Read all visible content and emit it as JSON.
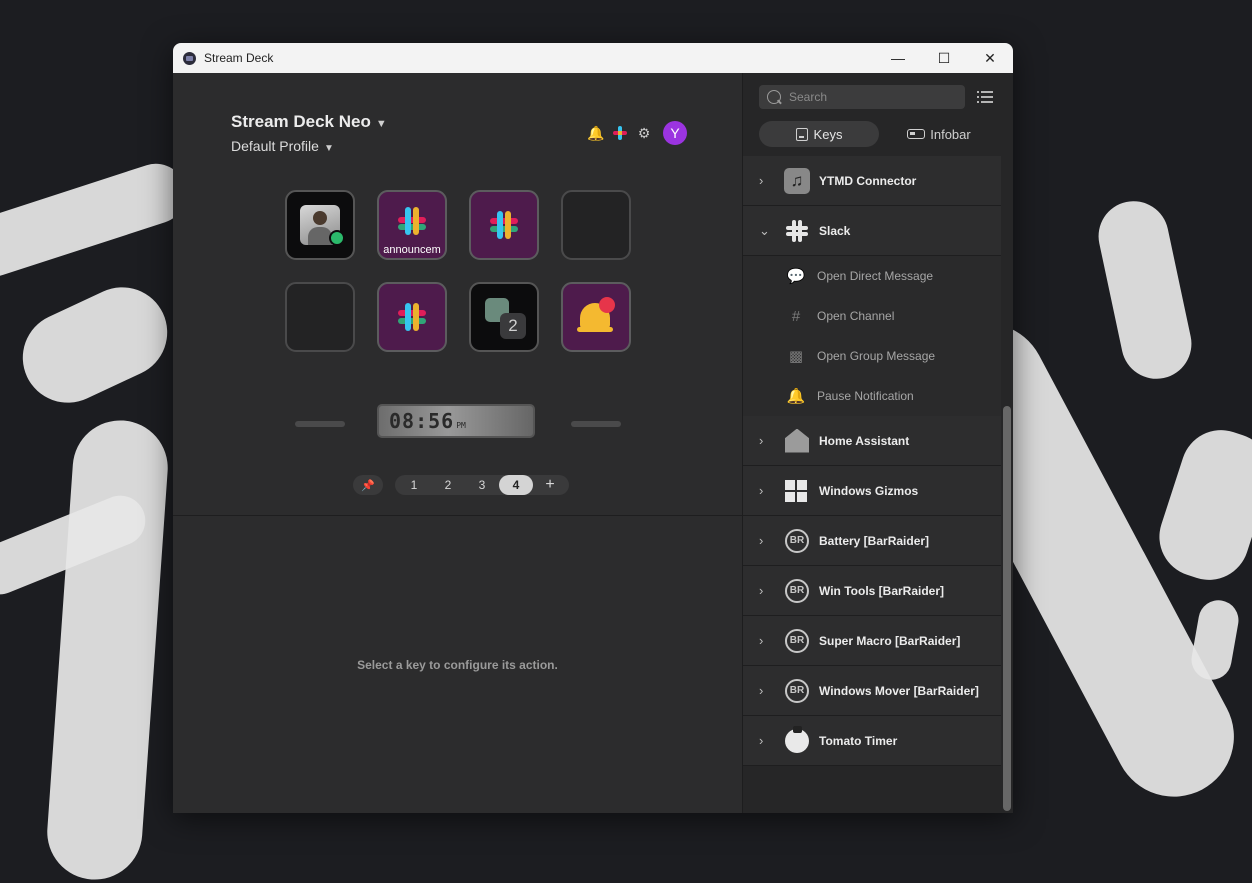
{
  "window": {
    "title": "Stream Deck",
    "controls": {
      "minimize": "—",
      "maximize": "☐",
      "close": "✕"
    }
  },
  "device": {
    "name": "Stream Deck Neo",
    "profile": "Default Profile",
    "avatar_letter": "Y"
  },
  "keys": [
    {
      "kind": "contact",
      "label": ""
    },
    {
      "kind": "slack",
      "label": "announcem"
    },
    {
      "kind": "slack",
      "label": ""
    },
    {
      "kind": "empty",
      "label": ""
    },
    {
      "kind": "empty",
      "label": ""
    },
    {
      "kind": "slack",
      "label": ""
    },
    {
      "kind": "group",
      "badge": "2"
    },
    {
      "kind": "bell",
      "label": ""
    }
  ],
  "infobar": {
    "time": "08:56",
    "ampm": "PM"
  },
  "pager": {
    "pin_icon": "📌",
    "pages": [
      "1",
      "2",
      "3",
      "4"
    ],
    "active_page": "4",
    "add": "+"
  },
  "config_hint": "Select a key to configure its action.",
  "sidebar": {
    "search_placeholder": "Search",
    "tabs": {
      "keys": "Keys",
      "infobar": "Infobar",
      "active": "keys"
    },
    "plugins": [
      {
        "name": "YTMD Connector",
        "icon": "music-note-icon",
        "expanded": false
      },
      {
        "name": "Slack",
        "icon": "slack-icon",
        "expanded": true,
        "actions": [
          "Open Direct Message",
          "Open Channel",
          "Open Group Message",
          "Pause Notification"
        ]
      },
      {
        "name": "Home Assistant",
        "icon": "home-assistant-icon",
        "expanded": false
      },
      {
        "name": "Windows Gizmos",
        "icon": "windows-icon",
        "expanded": false
      },
      {
        "name": "Battery [BarRaider]",
        "icon": "barraider-icon",
        "expanded": false
      },
      {
        "name": "Win Tools [BarRaider]",
        "icon": "barraider-icon",
        "expanded": false
      },
      {
        "name": "Super Macro [BarRaider]",
        "icon": "barraider-icon",
        "expanded": false
      },
      {
        "name": "Windows Mover [BarRaider]",
        "icon": "barraider-icon",
        "expanded": false
      },
      {
        "name": "Tomato Timer",
        "icon": "tomato-icon",
        "expanded": false
      }
    ]
  },
  "colors": {
    "slack_key_bg": "#4e1b4c",
    "avatar": "#9b34e0",
    "bell_notify": "#2aa3ff",
    "presence": "#2bba6b"
  }
}
